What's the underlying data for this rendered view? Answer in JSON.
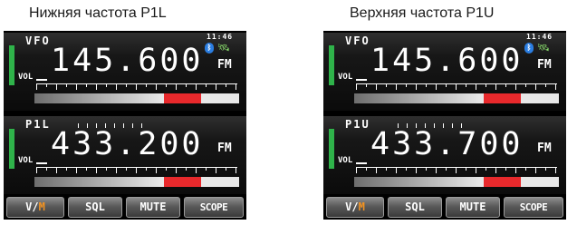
{
  "captions": {
    "left": "Нижняя частота P1L",
    "right": "Верхняя частота P1U"
  },
  "screens": [
    {
      "top": {
        "mode": "VFO",
        "frequency": "145.600",
        "modulation": "FM",
        "vol_label": "VOL",
        "time": "11:46"
      },
      "bottom": {
        "mode": "P1L",
        "frequency": "433.200",
        "modulation": "FM",
        "vol_label": "VOL"
      },
      "buttons": {
        "vm_v": "V/",
        "vm_m": "M",
        "sql": "SQL",
        "mute": "MUTE",
        "scope": "SCOPE"
      },
      "icons": {
        "bluetooth": "bluetooth-icon",
        "gps": "gps-satellite-icon"
      }
    },
    {
      "top": {
        "mode": "VFO",
        "frequency": "145.600",
        "modulation": "FM",
        "vol_label": "VOL",
        "time": "11:46"
      },
      "bottom": {
        "mode": "P1U",
        "frequency": "433.700",
        "modulation": "FM",
        "vol_label": "VOL"
      },
      "buttons": {
        "vm_v": "V/",
        "vm_m": "M",
        "sql": "SQL",
        "mute": "MUTE",
        "scope": "SCOPE"
      },
      "icons": {
        "bluetooth": "bluetooth-icon",
        "gps": "gps-satellite-icon"
      }
    }
  ],
  "colors": {
    "signal_bar": "#2fb34a",
    "meter_red": "#e8292c",
    "vm_accent": "#f39321",
    "bluetooth": "#2a7de1"
  }
}
